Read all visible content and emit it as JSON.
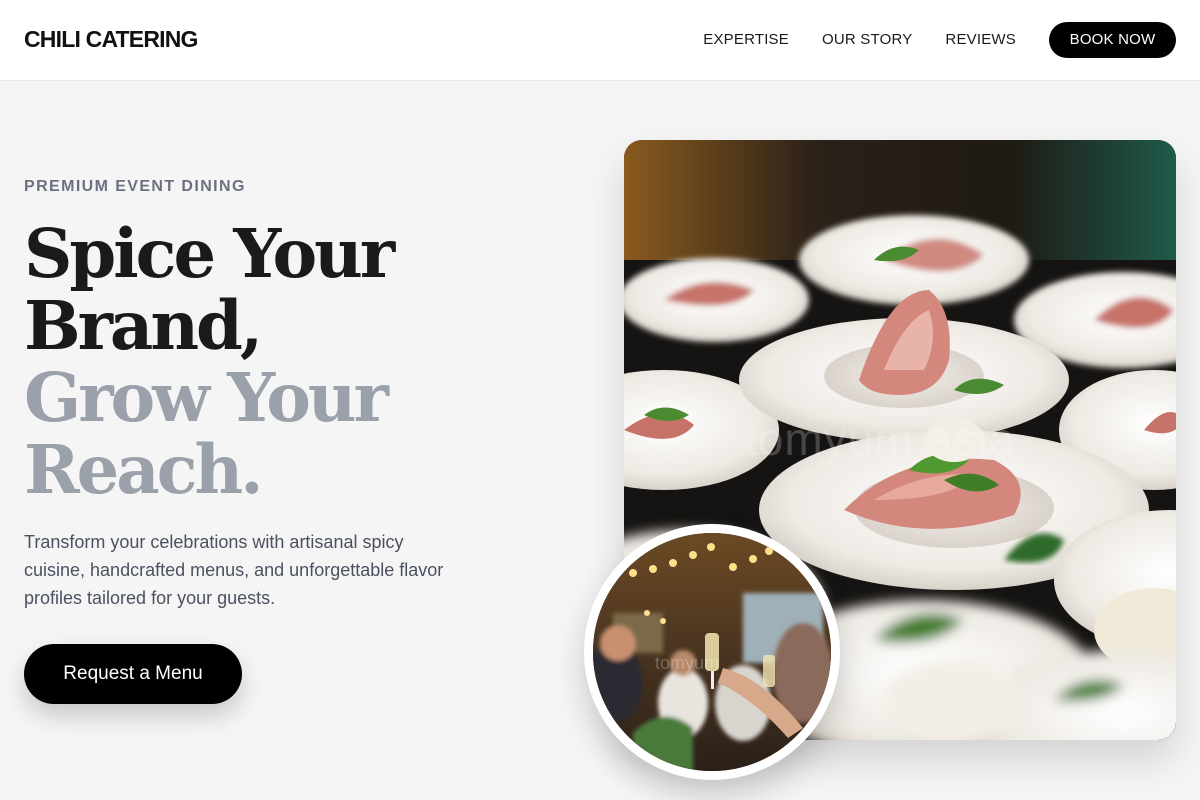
{
  "brand": {
    "name": "CHILI CATERING"
  },
  "nav": {
    "links": [
      "EXPERTISE",
      "OUR STORY",
      "REVIEWS"
    ],
    "cta_label": "BOOK NOW"
  },
  "hero": {
    "eyebrow": "PREMIUM EVENT DINING",
    "headline_dark_1": "Spice Your",
    "headline_dark_2": "Brand,",
    "headline_light_1": "Grow Your",
    "headline_light_2": "Reach.",
    "description": "Transform your celebrations with artisanal spicy cuisine, handcrafted menus, and unforgettable flavor profiles tailored for your guests.",
    "cta_label": "Request a Menu"
  },
  "images": {
    "main_image": "plated-appetizers-photo",
    "main_watermark": "tomyum asia",
    "circle_image": "event-guests-toasting-photo",
    "circle_watermark": "tomyum"
  },
  "colors": {
    "background": "#f5f5f5",
    "accent": "#000000",
    "headline_dark": "#1a1a1a",
    "headline_light": "#9aa1ab",
    "eyebrow": "#6b7180"
  }
}
